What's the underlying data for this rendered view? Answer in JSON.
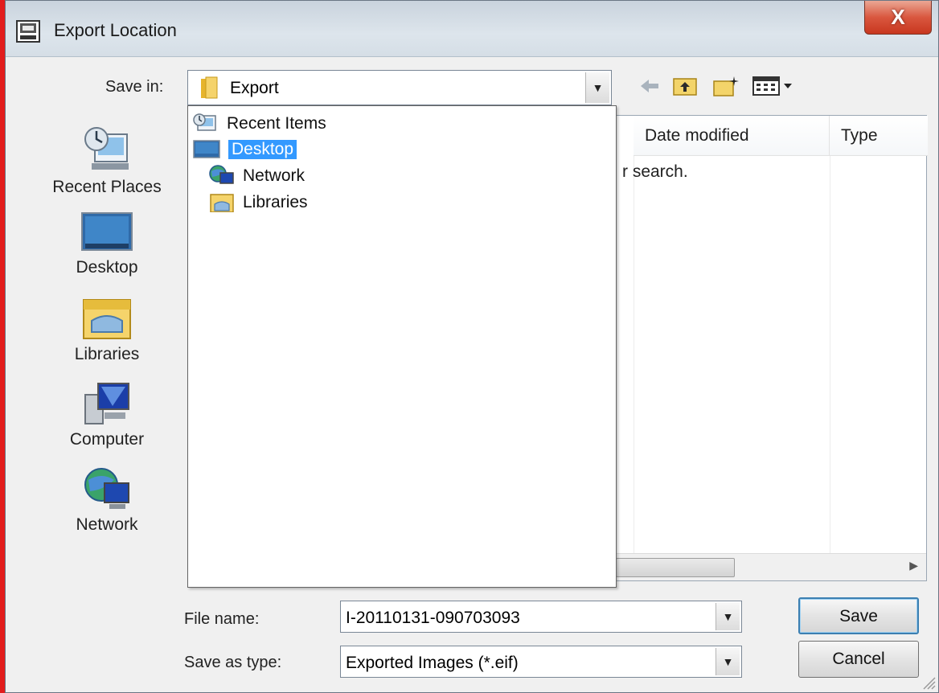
{
  "window": {
    "title": "Export Location",
    "close_symbol": "X"
  },
  "save_in": {
    "label": "Save in:",
    "value": "Export"
  },
  "toolbar_icons": [
    "back-arrow-icon",
    "up-folder-icon",
    "new-folder-icon",
    "view-menu-icon"
  ],
  "places": [
    {
      "label": "Recent Places",
      "icon": "recent-places-icon"
    },
    {
      "label": "Desktop",
      "icon": "desktop-icon"
    },
    {
      "label": "Libraries",
      "icon": "libraries-icon"
    },
    {
      "label": "Computer",
      "icon": "computer-icon"
    },
    {
      "label": "Network",
      "icon": "network-icon"
    }
  ],
  "file_list": {
    "columns": [
      "Date modified",
      "Type"
    ],
    "empty_message_fragment": "r search."
  },
  "dropdown": {
    "items": [
      {
        "label": "Recent Items",
        "icon": "recent-items-icon",
        "selected": false
      },
      {
        "label": "Desktop",
        "icon": "desktop-icon",
        "selected": true
      },
      {
        "label": "Network",
        "icon": "network-icon",
        "selected": false
      },
      {
        "label": "Libraries",
        "icon": "libraries-icon",
        "selected": false
      }
    ]
  },
  "file_name": {
    "label": "File name:",
    "value": "I-20110131-090703093"
  },
  "save_as_type": {
    "label": "Save as type:",
    "value": "Exported Images (*.eif)"
  },
  "buttons": {
    "save": "Save",
    "cancel": "Cancel"
  },
  "colors": {
    "selection": "#3399ff",
    "close_button": "#d9573f",
    "accent_edge": "#e21c1c"
  }
}
